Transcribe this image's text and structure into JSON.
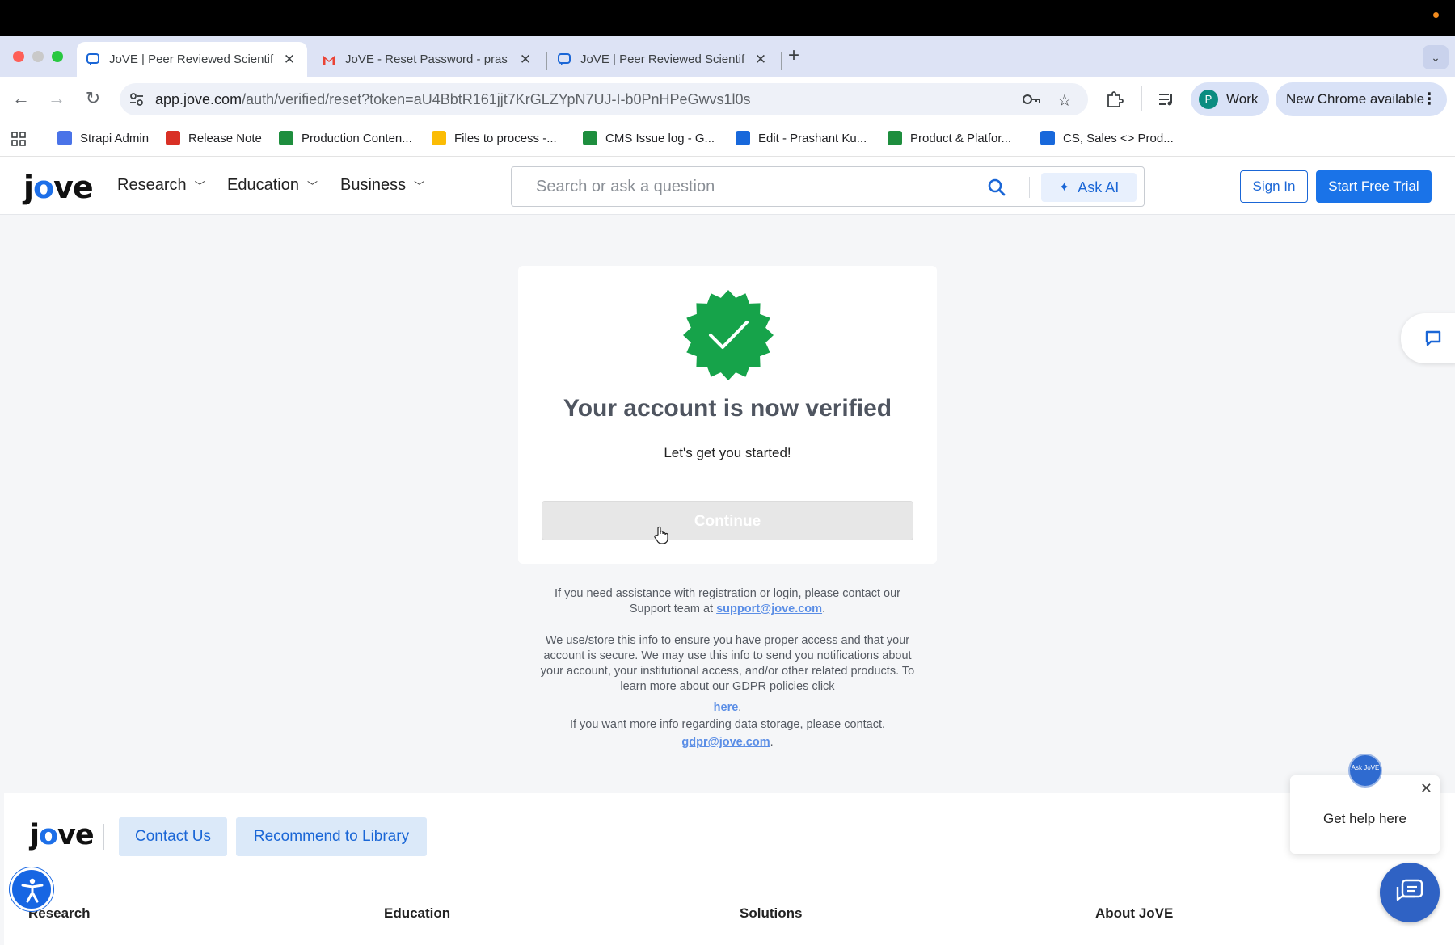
{
  "browser": {
    "tabs": [
      {
        "title": "JoVE | Peer Reviewed Scientif",
        "active": true
      },
      {
        "title": "JoVE - Reset Password - pras",
        "active": false
      },
      {
        "title": "JoVE | Peer Reviewed Scientif",
        "active": false
      }
    ],
    "close_glyph": "✕",
    "new_tab_glyph": "+",
    "url_host": "app.jove.com",
    "url_path": "/auth/verified/reset?token=aU4BbtR161jjt7KrGLZYpN7UJ-I-b0PnHPeGwvs1l0s",
    "profile_initial": "P",
    "profile_label": "Work",
    "update_label": "New Chrome available",
    "bookmarks": [
      {
        "label": "Strapi Admin",
        "icon": "strapi-icon",
        "color": "#4a73e8"
      },
      {
        "label": "Release Note",
        "icon": "gmail-icon",
        "color": "#d93025"
      },
      {
        "label": "Production Conten...",
        "icon": "sheets-icon",
        "color": "#1e8e3e"
      },
      {
        "label": "Files to process -...",
        "icon": "drive-icon",
        "color": "#fbbc04"
      },
      {
        "label": "CMS Issue log - G...",
        "icon": "sheets-icon",
        "color": "#1e8e3e"
      },
      {
        "label": "Edit - Prashant Ku...",
        "icon": "confluence-icon",
        "color": "#1868db"
      },
      {
        "label": "Product & Platfor...",
        "icon": "sheets-icon",
        "color": "#1e8e3e"
      },
      {
        "label": "CS, Sales <> Prod...",
        "icon": "confluence-icon",
        "color": "#1868db"
      }
    ]
  },
  "header": {
    "logo": {
      "j": "j",
      "o": "o",
      "ve": "ve"
    },
    "nav": [
      "Research",
      "Education",
      "Business"
    ],
    "search_placeholder": "Search or ask a question",
    "ask_ai": "Ask AI",
    "sign_in": "Sign In",
    "trial": "Start Free Trial"
  },
  "card": {
    "title": "Your account is now verified",
    "subtitle": "Let's get you started!",
    "button": "Continue",
    "badge_color": "#16a34a"
  },
  "info": {
    "support_text": "If you need assistance with registration or login, please contact our Support team at",
    "support_email": "support@jove.com",
    "gdpr_text": "We use/store this info to ensure you have proper access and that your account is secure. We may use this info to send you notifications about your account, your institutional access, and/or other related products. To learn more about our GDPR policies click",
    "gdpr_link": "here",
    "storage_text": "If you want more info regarding data storage, please contact.",
    "gdpr_email": "gdpr@jove.com",
    "period": "."
  },
  "footer": {
    "contact": "Contact Us",
    "recommend": "Recommend to Library",
    "columns": [
      "Research",
      "Education",
      "Solutions",
      "About JoVE"
    ]
  },
  "help": {
    "text": "Get help here",
    "badge": "Ask JoVE"
  }
}
